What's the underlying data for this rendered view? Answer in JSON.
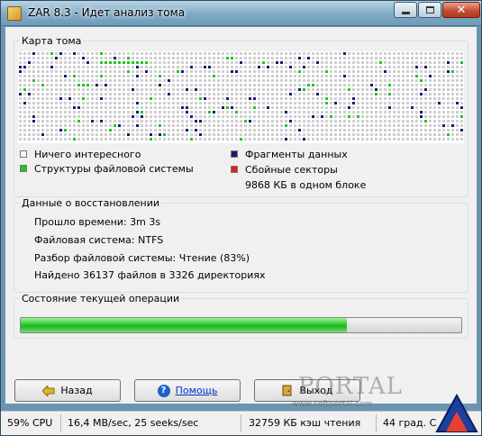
{
  "window": {
    "title": "ZAR 8.3 - Идет анализ тома"
  },
  "volume_map": {
    "title": "Карта тома",
    "colors": {
      "empty": "#cfcfcf",
      "fs": "#22c422",
      "data": "#1a1a6e",
      "bad": "#e02020"
    },
    "legend": [
      {
        "label": "Ничего интересного",
        "color": "#ffffff"
      },
      {
        "label": "Структуры файловой системы",
        "color": "#22c422"
      },
      {
        "label": "Фрагменты данных",
        "color": "#1a1a6e"
      },
      {
        "label": "Сбойные секторы",
        "sub": "9868 КБ в одном блоке",
        "color": "#e02020"
      }
    ]
  },
  "recovery": {
    "title": "Данные о восстановлении",
    "lines": [
      "Прошло времени: 3m 3s",
      "Файловая система: NTFS",
      "Разбор файловой системы: Чтение (83%)",
      "Найдено 36137 файлов в 3326 директориях"
    ]
  },
  "operation": {
    "title": "Состояние текущей операции",
    "progress": 0.74
  },
  "buttons": {
    "back": "Назад",
    "help": "Помощь",
    "exit": "Выход"
  },
  "status": {
    "cpu": "59% CPU",
    "speed": "16,4 MB/sec, 25 seeks/sec",
    "cache": "32759 КБ кэш чтения",
    "temp": "44 град. C"
  },
  "watermark": {
    "text": "PORTAL",
    "url": "www.softportal.com"
  },
  "icons": {
    "app": "zar-app-icon",
    "back": "back-arrow-icon",
    "help": "help-icon",
    "exit": "exit-door-icon"
  }
}
